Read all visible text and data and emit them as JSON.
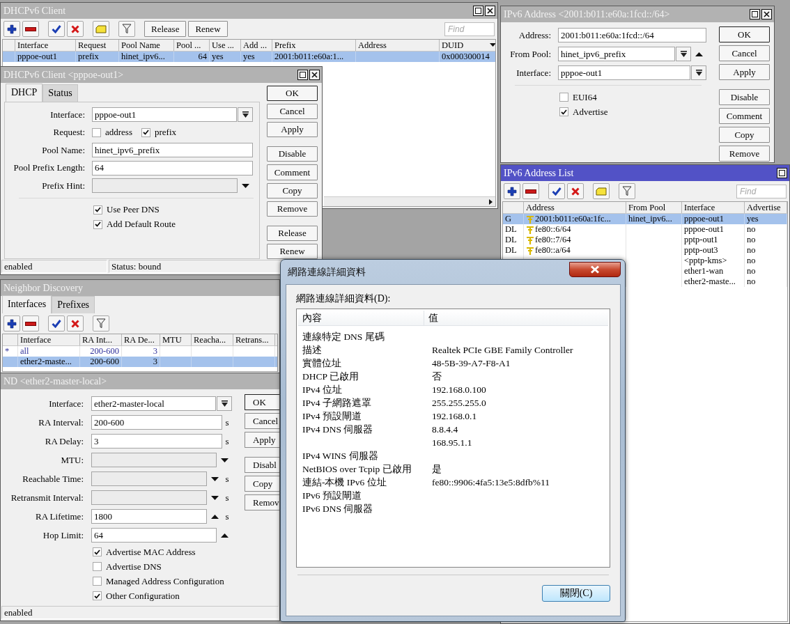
{
  "dhcp_client_list": {
    "title": "DHCPv6 Client",
    "active": false,
    "tool_buttons": [
      "Release",
      "Renew"
    ],
    "find_placeholder": "Find",
    "columns": [
      "Interface",
      "Request",
      "Pool Name",
      "Pool ...",
      "Use ...",
      "Add ...",
      "Prefix",
      "Address",
      "DUID"
    ],
    "rows": [
      {
        "selected": true,
        "interface": "pppoe-out1",
        "request": "prefix",
        "pool_name": "hinet_ipv6...",
        "pool_prefix_length": "64",
        "use_peer_dns": "yes",
        "add_default_route": "yes",
        "prefix": "2001:b011:e60a:1...",
        "duid": "0x000300014"
      }
    ]
  },
  "dhcp_client_form": {
    "title": "DHCPv6 Client <pppoe-out1>",
    "active": false,
    "tabs": [
      {
        "label": "DHCP",
        "selected": true
      },
      {
        "label": "Status",
        "selected": false
      }
    ],
    "fields": [
      {
        "kind": "select",
        "label": "Interface:",
        "value": "pppoe-out1"
      },
      {
        "kind": "checks",
        "label": "Request:",
        "options": [
          {
            "label": "address",
            "checked": false
          },
          {
            "label": "prefix",
            "checked": true
          }
        ]
      },
      {
        "kind": "text",
        "label": "Pool Name:",
        "value": "hinet_ipv6_prefix"
      },
      {
        "kind": "text",
        "label": "Pool Prefix Length:",
        "value": "64"
      },
      {
        "kind": "combo",
        "label": "Prefix Hint:"
      }
    ],
    "checkboxes": [
      {
        "label": "Use Peer DNS",
        "checked": true
      },
      {
        "label": "Add Default Route",
        "checked": true
      }
    ],
    "buttons": [
      [
        "OK",
        "Cancel",
        "Apply"
      ],
      [
        "Disable",
        "Comment",
        "Copy",
        "Remove"
      ],
      [
        "Release",
        "Renew"
      ]
    ],
    "status": [
      "enabled",
      "Status: bound"
    ]
  },
  "ipv6_address_form": {
    "title": "IPv6 Address <2001:b011:e60a:1fcd::/64>",
    "active": false,
    "fields": [
      {
        "kind": "text",
        "label": "Address:",
        "value": "2001:b011:e60a:1fcd::/64"
      },
      {
        "kind": "select_up",
        "label": "From Pool:",
        "value": "hinet_ipv6_prefix"
      },
      {
        "kind": "select",
        "label": "Interface:",
        "value": "pppoe-out1"
      }
    ],
    "checkboxes": [
      {
        "label": "EUI64",
        "checked": false
      },
      {
        "label": "Advertise",
        "checked": true
      }
    ],
    "buttons": [
      [
        "OK",
        "Cancel",
        "Apply"
      ],
      [
        "Disable",
        "Comment",
        "Copy",
        "Remove"
      ]
    ]
  },
  "ipv6_address_list": {
    "title": "IPv6 Address List",
    "active": true,
    "find_placeholder": "Find",
    "columns": [
      "Address",
      "From Pool",
      "Interface",
      "Advertise"
    ],
    "rows": [
      {
        "selected": true,
        "flag": "G",
        "address": "2001:b011:e60a:1fc...",
        "from_pool": "hinet_ipv6...",
        "interface": "pppoe-out1",
        "advertise": "yes"
      },
      {
        "selected": false,
        "flag": "DL",
        "address": "fe80::6/64",
        "interface": "pppoe-out1",
        "advertise": "no"
      },
      {
        "selected": false,
        "flag": "DL",
        "address": "fe80::7/64",
        "interface": "pptp-out1",
        "advertise": "no"
      },
      {
        "selected": false,
        "flag": "DL",
        "address": "fe80::a/64",
        "interface": "pptp-out3",
        "advertise": "no"
      },
      {
        "selected": false,
        "interface": "<pptp-kms>",
        "advertise": "no"
      },
      {
        "selected": false,
        "interface": "ether1-wan",
        "advertise": "no"
      },
      {
        "selected": false,
        "interface": "ether2-maste...",
        "advertise": "no"
      }
    ]
  },
  "neighbor_discovery": {
    "title": "Neighbor Discovery",
    "active": false,
    "tabs": [
      {
        "label": "Interfaces",
        "selected": true
      },
      {
        "label": "Prefixes",
        "selected": false
      }
    ],
    "columns": [
      "Interface",
      "RA Int...",
      "RA De...",
      "MTU",
      "Reacha...",
      "Retrans..."
    ],
    "rows": [
      {
        "selected": false,
        "flag": "*",
        "interface": "all",
        "ra_interval": "200-600",
        "ra_delay": "3"
      },
      {
        "selected": true,
        "interface": "ether2-maste...",
        "ra_interval": "200-600",
        "ra_delay": "3"
      }
    ]
  },
  "nd_form": {
    "title": "ND <ether2-master-local>",
    "active": false,
    "fields": [
      {
        "kind": "select",
        "label": "Interface:",
        "value": "ether2-master-local"
      },
      {
        "kind": "text",
        "label": "RA Interval:",
        "value": "200-600",
        "unit": "s"
      },
      {
        "kind": "text",
        "label": "RA Delay:",
        "value": "3",
        "unit": "s"
      },
      {
        "kind": "combo",
        "label": "MTU:"
      },
      {
        "kind": "combo",
        "label": "Reachable Time:",
        "unit": "s"
      },
      {
        "kind": "combo",
        "label": "Retransmit Interval:",
        "unit": "s"
      },
      {
        "kind": "spin",
        "label": "RA Lifetime:",
        "value": "1800",
        "unit": "s"
      },
      {
        "kind": "spin",
        "label": "Hop Limit:",
        "value": "64"
      }
    ],
    "checkboxes": [
      {
        "label": "Advertise MAC Address",
        "checked": true
      },
      {
        "label": "Advertise DNS",
        "checked": false
      },
      {
        "label": "Managed Address Configuration",
        "checked": false
      },
      {
        "label": "Other Configuration",
        "checked": true
      }
    ],
    "buttons": [
      [
        "OK",
        "Cancel",
        "Apply"
      ],
      [
        "Disabl",
        "Copy",
        "Remov"
      ]
    ],
    "status": [
      "enabled"
    ]
  },
  "details_dialog": {
    "title": "網路連線詳細資料",
    "list_label": "網路連線詳細資料(D):",
    "columns": [
      "內容",
      "值"
    ],
    "rows": [
      {
        "property": "連線特定 DNS 尾碼"
      },
      {
        "property": "描述",
        "value": "Realtek PCIe GBE Family Controller"
      },
      {
        "property": "實體位址",
        "value": "48-5B-39-A7-F8-A1"
      },
      {
        "property": "DHCP 已啟用",
        "value": "否"
      },
      {
        "property": "IPv4 位址",
        "value": "192.168.0.100"
      },
      {
        "property": "IPv4 子網路遮罩",
        "value": "255.255.255.0"
      },
      {
        "property": "IPv4 預設閘道",
        "value": "192.168.0.1"
      },
      {
        "property": "IPv4 DNS 伺服器",
        "value": "8.8.4.4"
      },
      {
        "value": "168.95.1.1"
      },
      {
        "property": "IPv4 WINS 伺服器"
      },
      {
        "property": "NetBIOS over Tcpip 已啟用",
        "value": "是"
      },
      {
        "property": "連結-本機 IPv6 位址",
        "value": "fe80::9906:4fa5:13e5:8dfb%11"
      },
      {
        "property": "IPv6 預設閘道"
      },
      {
        "property": "IPv6 DNS 伺服器"
      }
    ],
    "close_button": "關閉(C)"
  }
}
